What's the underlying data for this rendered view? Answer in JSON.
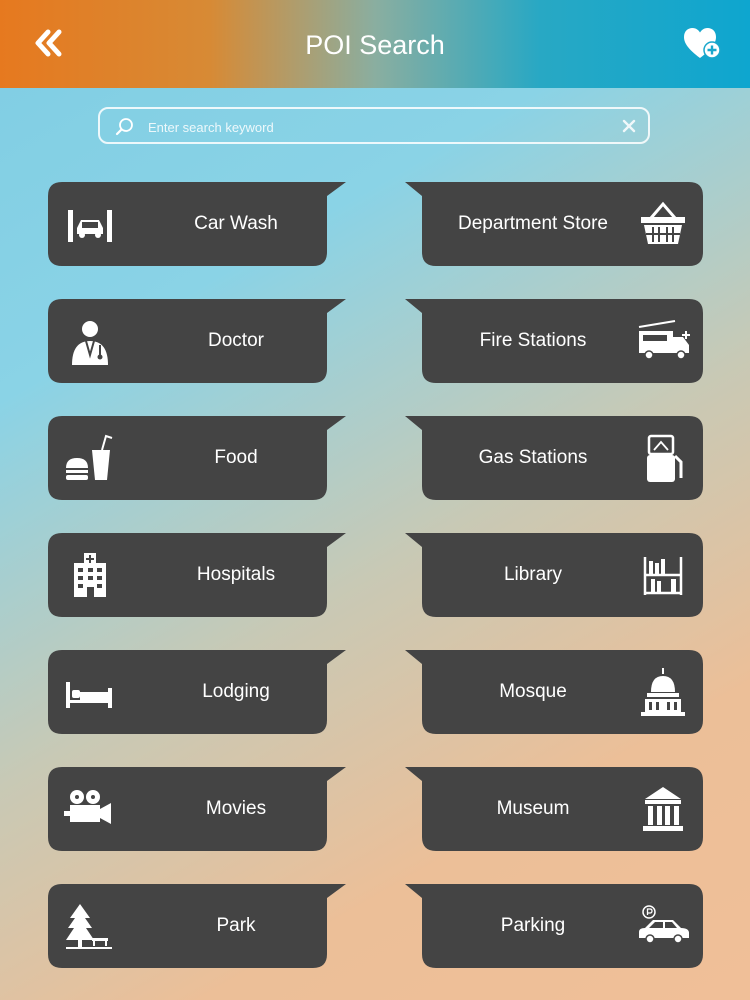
{
  "header": {
    "title": "POI Search"
  },
  "search": {
    "placeholder": "Enter search keyword"
  },
  "categories": [
    {
      "label": "Car Wash",
      "icon": "car-wash-icon"
    },
    {
      "label": "Department Store",
      "icon": "shopping-basket-icon"
    },
    {
      "label": "Doctor",
      "icon": "doctor-icon"
    },
    {
      "label": "Fire Stations",
      "icon": "fire-truck-icon"
    },
    {
      "label": "Food",
      "icon": "food-icon"
    },
    {
      "label": "Gas Stations",
      "icon": "gas-pump-icon"
    },
    {
      "label": "Hospitals",
      "icon": "hospital-building-icon"
    },
    {
      "label": "Library",
      "icon": "bookshelf-icon"
    },
    {
      "label": "Lodging",
      "icon": "bed-icon"
    },
    {
      "label": "Mosque",
      "icon": "mosque-dome-icon"
    },
    {
      "label": "Movies",
      "icon": "movie-camera-icon"
    },
    {
      "label": "Museum",
      "icon": "museum-icon"
    },
    {
      "label": "Park",
      "icon": "tree-bench-icon"
    },
    {
      "label": "Parking",
      "icon": "parking-car-icon"
    }
  ],
  "colors": {
    "tile": "#444444",
    "header_left": "#e6791f",
    "header_right": "#0ea6cf",
    "text": "#ffffff"
  }
}
